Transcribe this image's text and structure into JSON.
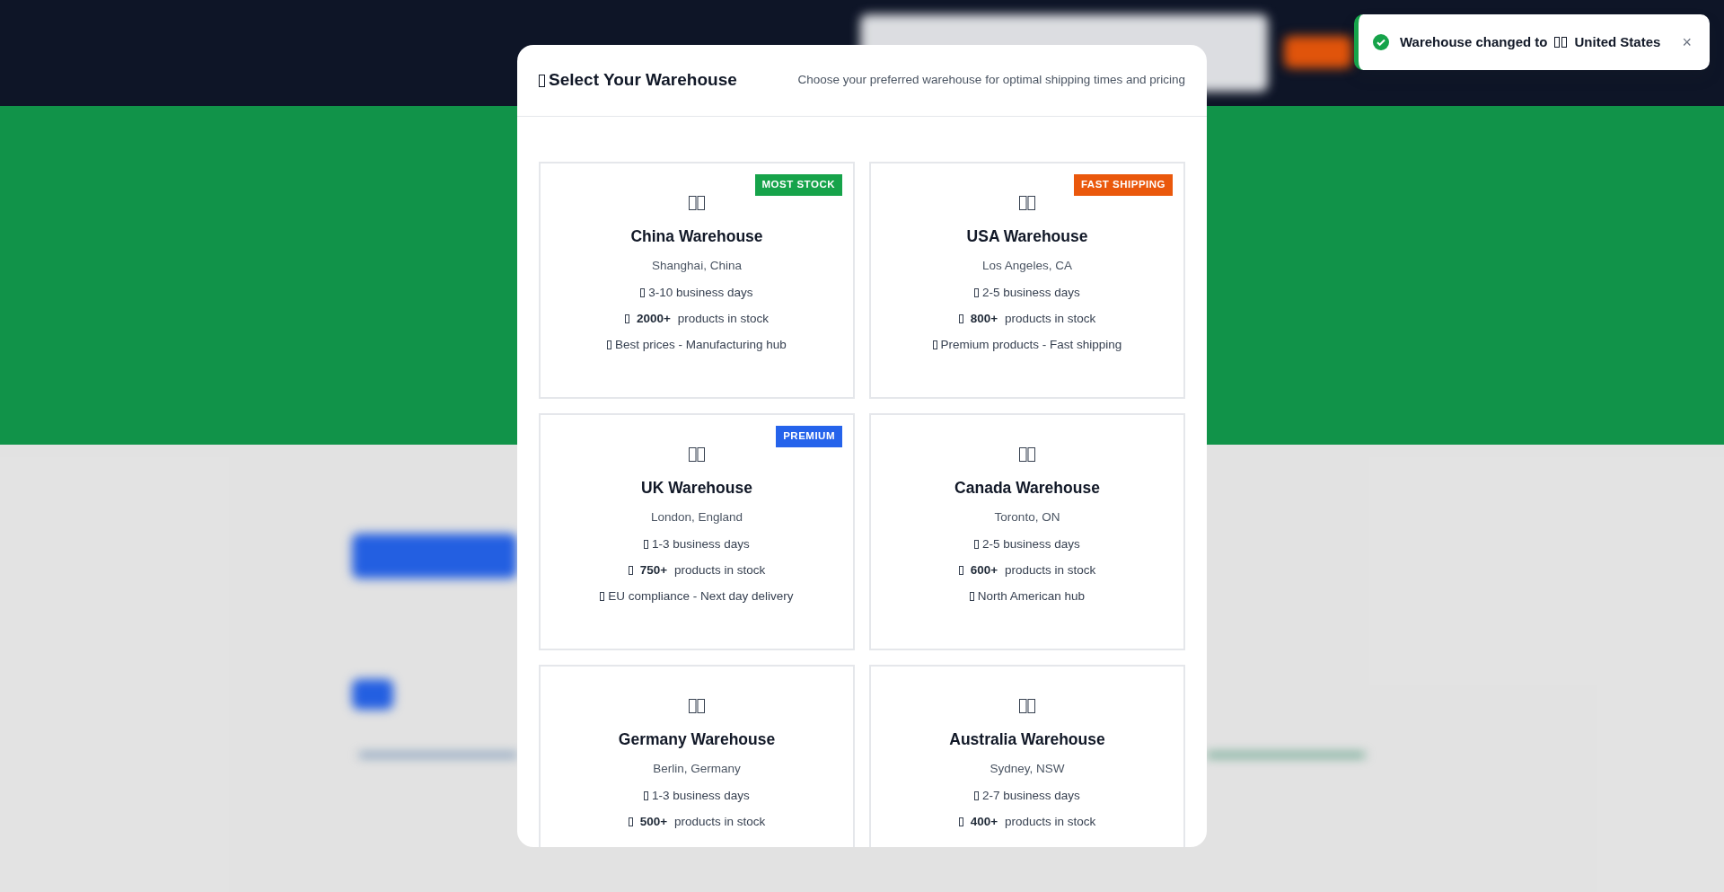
{
  "modal": {
    "title": "Select Your Warehouse",
    "subtitle": "Choose your preferred warehouse for optimal shipping times and pricing",
    "warehouses": [
      {
        "name": "China Warehouse",
        "location": "Shanghai, China",
        "delivery": "3-10 business days",
        "stock": "2000+",
        "stock_label": "products in stock",
        "note": "Best prices - Manufacturing hub",
        "badge": {
          "text": "MOST STOCK",
          "color": "#16a34a"
        }
      },
      {
        "name": "USA Warehouse",
        "location": "Los Angeles, CA",
        "delivery": "2-5 business days",
        "stock": "800+",
        "stock_label": "products in stock",
        "note": "Premium products - Fast shipping",
        "badge": {
          "text": "FAST SHIPPING",
          "color": "#ea580c"
        }
      },
      {
        "name": "UK Warehouse",
        "location": "London, England",
        "delivery": "1-3 business days",
        "stock": "750+",
        "stock_label": "products in stock",
        "note": "EU compliance - Next day delivery",
        "badge": {
          "text": "PREMIUM",
          "color": "#2563eb"
        }
      },
      {
        "name": "Canada Warehouse",
        "location": "Toronto, ON",
        "delivery": "2-5 business days",
        "stock": "600+",
        "stock_label": "products in stock",
        "note": "North American hub"
      },
      {
        "name": "Germany Warehouse",
        "location": "Berlin, Germany",
        "delivery": "1-3 business days",
        "stock": "500+",
        "stock_label": "products in stock"
      },
      {
        "name": "Australia Warehouse",
        "location": "Sydney, NSW",
        "delivery": "2-7 business days",
        "stock": "400+",
        "stock_label": "products in stock"
      }
    ]
  },
  "toast": {
    "message": "Warehouse changed to",
    "country": "United States",
    "close": "×"
  }
}
